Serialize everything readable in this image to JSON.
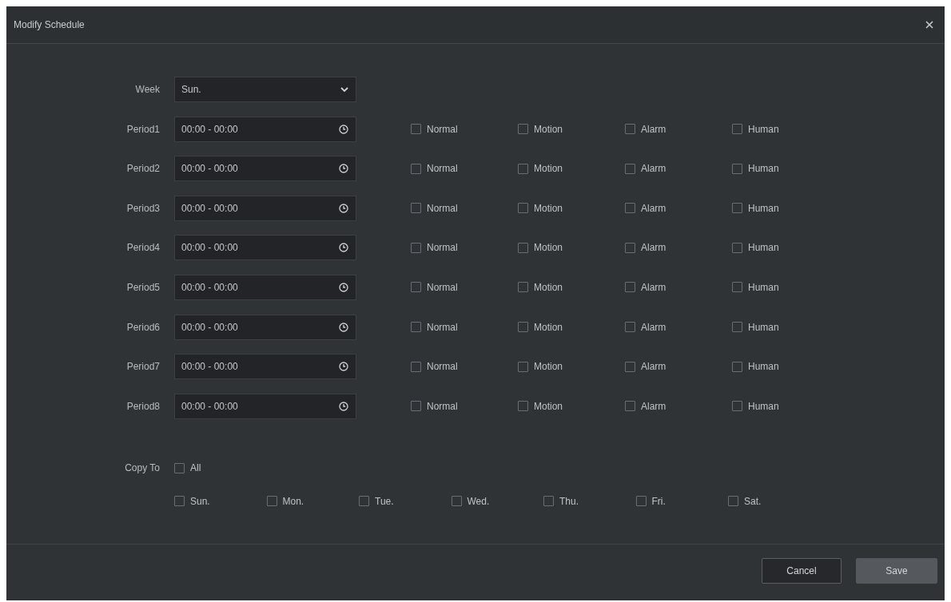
{
  "dialog": {
    "title": "Modify Schedule"
  },
  "week": {
    "label": "Week",
    "value": "Sun."
  },
  "periods": [
    {
      "label": "Period1",
      "value": "00:00 - 00:00",
      "options": [
        {
          "label": "Normal",
          "checked": false
        },
        {
          "label": "Motion",
          "checked": false
        },
        {
          "label": "Alarm",
          "checked": false
        },
        {
          "label": "Human",
          "checked": false
        }
      ]
    },
    {
      "label": "Period2",
      "value": "00:00 - 00:00",
      "options": [
        {
          "label": "Normal",
          "checked": false
        },
        {
          "label": "Motion",
          "checked": false
        },
        {
          "label": "Alarm",
          "checked": false
        },
        {
          "label": "Human",
          "checked": false
        }
      ]
    },
    {
      "label": "Period3",
      "value": "00:00 - 00:00",
      "options": [
        {
          "label": "Normal",
          "checked": false
        },
        {
          "label": "Motion",
          "checked": false
        },
        {
          "label": "Alarm",
          "checked": false
        },
        {
          "label": "Human",
          "checked": false
        }
      ]
    },
    {
      "label": "Period4",
      "value": "00:00 - 00:00",
      "options": [
        {
          "label": "Normal",
          "checked": false
        },
        {
          "label": "Motion",
          "checked": false
        },
        {
          "label": "Alarm",
          "checked": false
        },
        {
          "label": "Human",
          "checked": false
        }
      ]
    },
    {
      "label": "Period5",
      "value": "00:00 - 00:00",
      "options": [
        {
          "label": "Normal",
          "checked": false
        },
        {
          "label": "Motion",
          "checked": false
        },
        {
          "label": "Alarm",
          "checked": false
        },
        {
          "label": "Human",
          "checked": false
        }
      ]
    },
    {
      "label": "Period6",
      "value": "00:00 - 00:00",
      "options": [
        {
          "label": "Normal",
          "checked": false
        },
        {
          "label": "Motion",
          "checked": false
        },
        {
          "label": "Alarm",
          "checked": false
        },
        {
          "label": "Human",
          "checked": false
        }
      ]
    },
    {
      "label": "Period7",
      "value": "00:00 - 00:00",
      "options": [
        {
          "label": "Normal",
          "checked": false
        },
        {
          "label": "Motion",
          "checked": false
        },
        {
          "label": "Alarm",
          "checked": false
        },
        {
          "label": "Human",
          "checked": false
        }
      ]
    },
    {
      "label": "Period8",
      "value": "00:00 - 00:00",
      "options": [
        {
          "label": "Normal",
          "checked": false
        },
        {
          "label": "Motion",
          "checked": false
        },
        {
          "label": "Alarm",
          "checked": false
        },
        {
          "label": "Human",
          "checked": false
        }
      ]
    }
  ],
  "copy_to": {
    "label": "Copy To",
    "all": {
      "label": "All",
      "checked": false
    },
    "days": [
      {
        "label": "Sun.",
        "checked": false
      },
      {
        "label": "Mon.",
        "checked": false
      },
      {
        "label": "Tue.",
        "checked": false
      },
      {
        "label": "Wed.",
        "checked": false
      },
      {
        "label": "Thu.",
        "checked": false
      },
      {
        "label": "Fri.",
        "checked": false
      },
      {
        "label": "Sat.",
        "checked": false
      }
    ]
  },
  "buttons": [
    {
      "label": "Cancel",
      "kind": "secondary"
    },
    {
      "label": "Save",
      "kind": "primary"
    }
  ]
}
